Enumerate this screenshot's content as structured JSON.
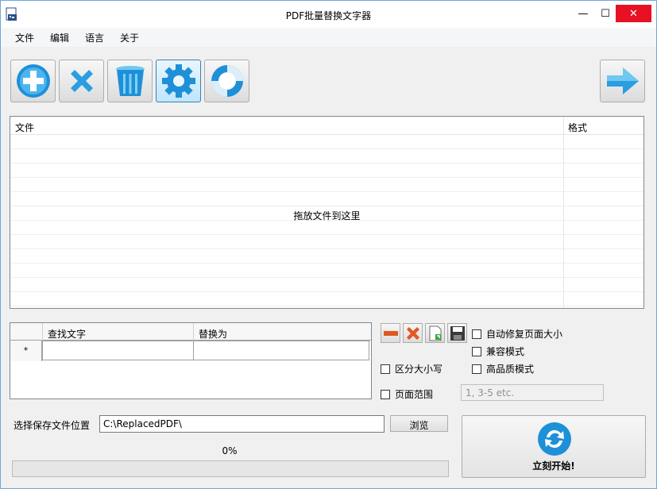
{
  "window": {
    "title": "PDF批量替换文字器"
  },
  "titlebar_buttons": {
    "minimize": "—",
    "maximize": "☐",
    "close": "✕"
  },
  "menu": [
    "文件",
    "编辑",
    "语言",
    "关于"
  ],
  "toolbar": {
    "icons": [
      "add-icon",
      "remove-icon",
      "trash-icon",
      "settings-icon",
      "help-icon"
    ],
    "next_icon": "arrow-right-icon",
    "colors": {
      "accent": "#1e90d8",
      "light": "#7fd0f5"
    }
  },
  "file_list": {
    "columns": [
      "文件",
      "格式"
    ],
    "drop_hint": "拖放文件到这里",
    "row_count": 12
  },
  "replace_grid": {
    "columns": [
      "查找文字",
      "替换为"
    ],
    "new_row_marker": "*"
  },
  "row_actions": {
    "icons": [
      "minus-icon",
      "delete-icon",
      "import-icon",
      "save-icon"
    ]
  },
  "options": {
    "auto_fix_page_size": {
      "label": "自动修复页面大小",
      "checked": false
    },
    "compat_mode": {
      "label": "兼容模式",
      "checked": false
    },
    "case_sensitive": {
      "label": "区分大小写",
      "checked": false
    },
    "high_quality": {
      "label": "高品质模式",
      "checked": false
    },
    "page_range": {
      "label": "页面范围",
      "checked": false,
      "placeholder": "1, 3-5 etc."
    }
  },
  "output": {
    "label": "选择保存文件位置",
    "path": "C:\\ReplacedPDF\\",
    "browse": "浏览"
  },
  "progress": {
    "text": "0%",
    "value": 0
  },
  "start": {
    "label": "立刻开始!",
    "icon": "refresh-icon"
  }
}
